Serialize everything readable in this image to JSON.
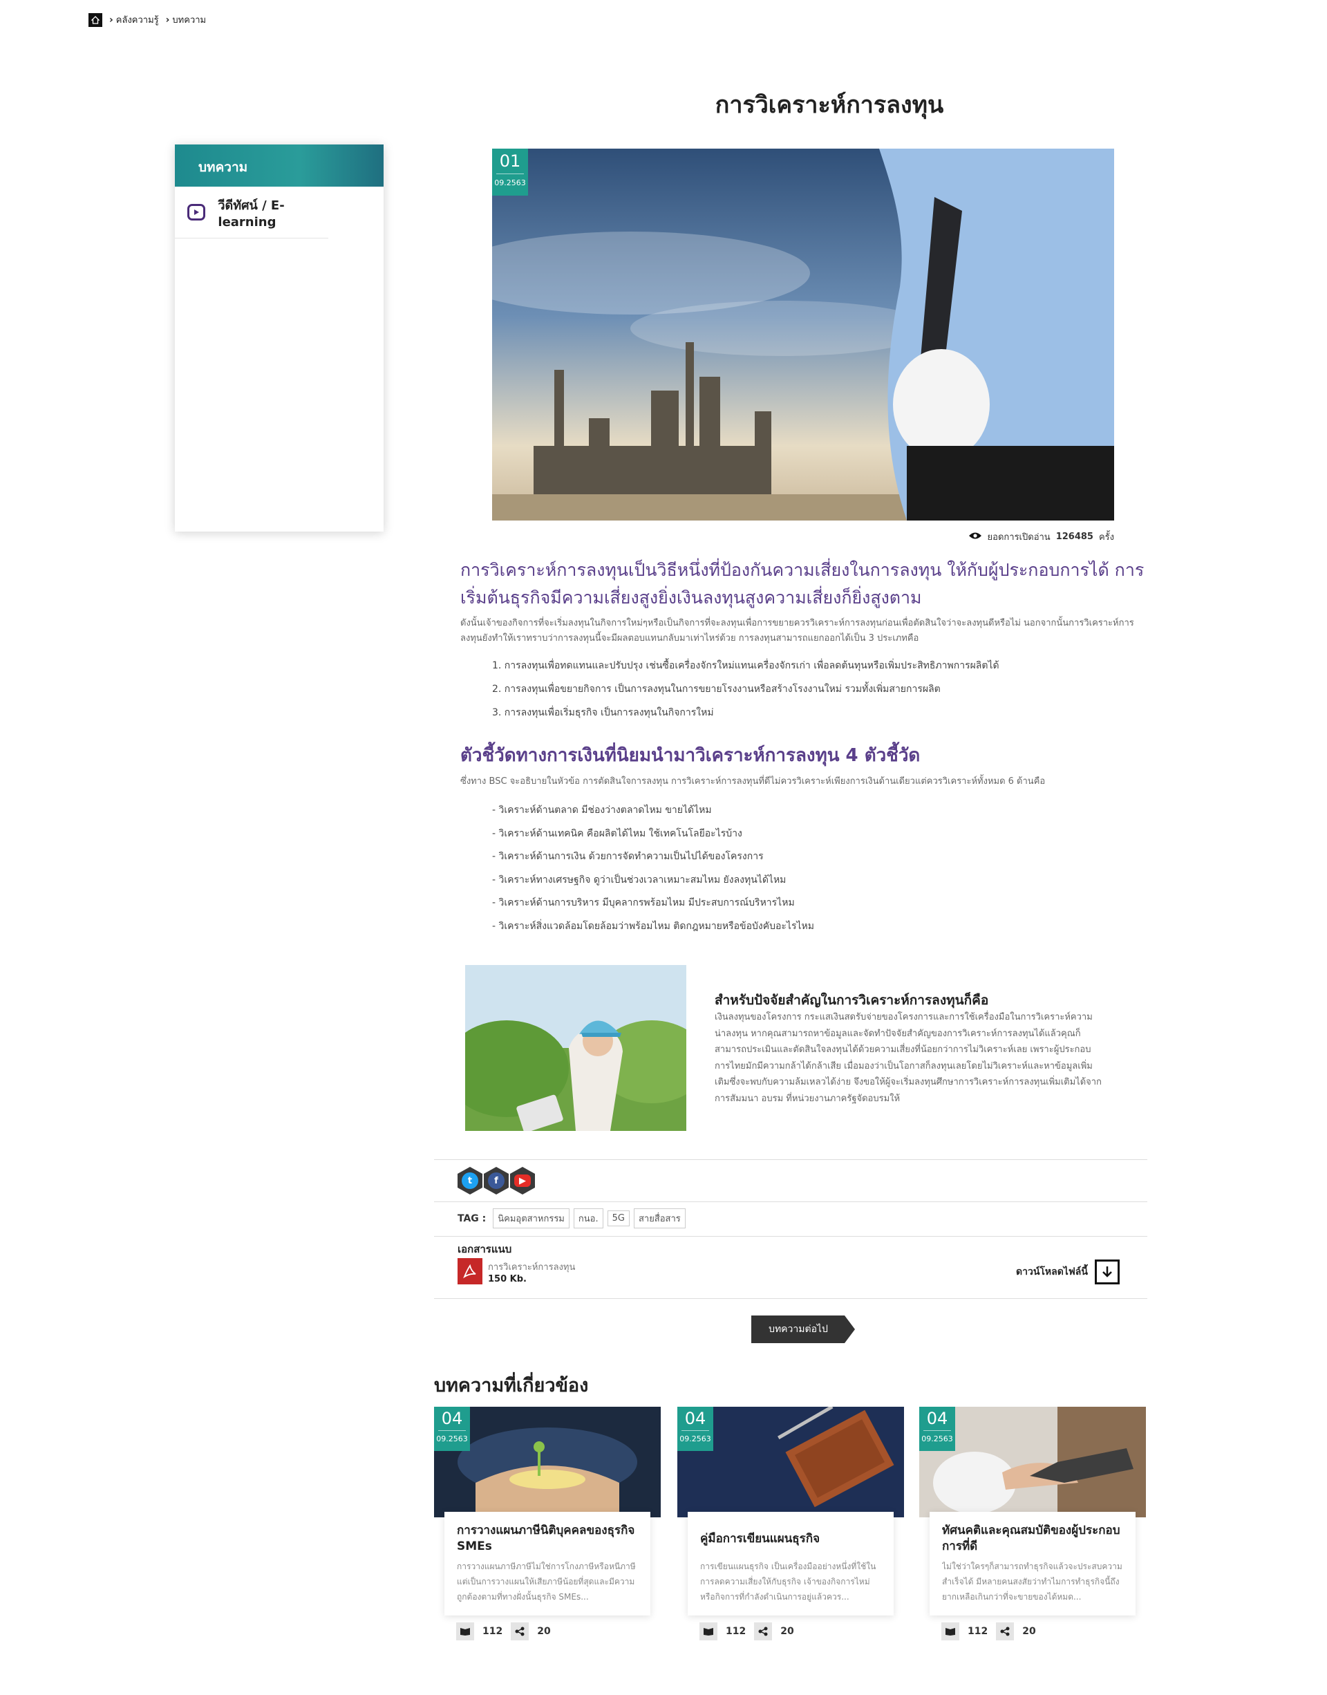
{
  "breadcrumb": {
    "items": [
      "คลังความรู้",
      "บทความ"
    ]
  },
  "page_title": "การวิเคราะห์การลงทุน",
  "sidebar": {
    "header": "บทความ",
    "items": [
      {
        "label": "วีดีทัศน์ / E-learning",
        "icon": "play-icon"
      }
    ]
  },
  "article": {
    "date_day": "01",
    "date_month": "09.2563",
    "views_text": "ยอดการเปิดอ่าน",
    "views_count": "126485",
    "views_unit": "ครั้ง",
    "lead": "การวิเคราะห์การลงทุนเป็นวิธีหนึ่งที่ป้องกันความเสี่ยงในการลงทุน ให้กับผู้ประกอบการได้ การเริ่มต้นธุรกิจมีความเสี่ยงสูงยิ่งเงินลงทุนสูงความเสี่ยงก็ยิ่งสูงตาม",
    "paragraph": "ดังนั้นเจ้าของกิจการที่จะเริ่มลงทุนในกิจการใหม่ๆหรือเป็นกิจการที่จะลงทุนเพื่อการขยายควรวิเคราะห์การลงทุนก่อนเพื่อตัดสินใจว่าจะลงทุนดีหรือไม่ นอกจากนั้นการวิเคราะห์การลงทุนยังทำให้เราทราบว่าการลงทุนนี้จะมีผลตอบแทนกลับมาเท่าไหร่ด้วย การลงทุนสามารถแยกออกได้เป็น 3 ประเภทคือ",
    "list1": [
      "1. การลงทุนเพื่อทดแทนและปรับปรุง เช่นซื้อเครื่องจักรใหม่แทนเครื่องจักรเก่า เพื่อลดต้นทุนหรือเพิ่มประสิทธิภาพการผลิตได้",
      "2. การลงทุนเพื่อขยายกิจการ เป็นการลงทุนในการขยายโรงงานหรือสร้างโรงงานใหม่ รวมทั้งเพิ่มสายการผลิต",
      "3. การลงทุนเพื่อเริ่มธุรกิจ เป็นการลงทุนในกิจการใหม่"
    ],
    "heading2": "ตัวชี้วัดทางการเงินที่นิยมนำมาวิเคราะห์การลงทุน 4 ตัวชี้วัด",
    "paragraph2": "ซึ่งทาง BSC จะอธิบายในหัวข้อ การตัดสินใจการลงทุน การวิเคราะห์การลงทุนที่ดีไม่ควรวิเคราะห์เพียงการเงินด้านเดียวแต่ควรวิเคราะห์ทั้งหมด 6 ด้านคือ",
    "list2": [
      "- วิเคราะห์ด้านตลาด มีช่องว่างตลาดไหม ขายได้ไหม",
      "- วิเคราะห์ด้านเทคนิค คือผลิตได้ไหม ใช้เทคโนโลยีอะไรบ้าง",
      "- วิเคราะห์ด้านการเงิน ด้วยการจัดทำความเป็นไปได้ของโครงการ",
      "- วิเคราะห์ทางเศรษฐกิจ ดูว่าเป็นช่วงเวลาเหมาะสมไหม ยังลงทุนได้ไหม",
      "- วิเคราะห์ด้านการบริหาร มีบุคลากรพร้อมไหม มีประสบการณ์บริหารไหม",
      "- วิเคราะห์สิ่งแวดล้อมโดยล้อมว่าพร้อมไหม ติดกฎหมายหรือข้อบังคับอะไรไหม"
    ],
    "feature_title": "สำหรับปัจจัยสำคัญในการวิเคราะห์การลงทุนก็คือ",
    "feature_text": "เงินลงทุนของโครงการ กระแสเงินสดรับจ่ายของโครงการและการใช้เครื่องมือในการวิเคราะห์ความน่าลงทุน หากคุณสามารถหาข้อมูลและจัดทำปัจจัยสำคัญของการวิเคราะห์การลงทุนได้แล้วคุณก็สามารถประเมินและตัดสินใจลงทุนได้ด้วยความเสี่ยงที่น้อยกว่าการไม่วิเคราะห์เลย เพราะผู้ประกอบการไทยมักมีความกล้าได้กล้าเสีย เมื่อมองว่าเป็นโอกาสก็ลงทุนเลยโดยไม่วิเคราะห์และหาข้อมูลเพิ่มเติมซึ่งจะพบกับความล้มเหลวได้ง่าย จึงขอให้ผู้จะเริ่มลงทุนศึกษาการวิเคราะห์การลงทุนเพิ่มเติมได้จากการสัมมนา อบรม ที่หน่วยงานภาครัฐจัดอบรมให้"
  },
  "social": [
    "twitter-icon",
    "facebook-icon",
    "youtube-icon"
  ],
  "tags": {
    "label": "TAG :",
    "items": [
      "นิคมอุตสาหกรรม",
      "กนอ.",
      "5G",
      "สายสื่อสาร"
    ]
  },
  "attachment": {
    "title": "เอกสารแนบ",
    "file_name": "การวิเคราะห์การลงทุน",
    "file_size": "150 Kb.",
    "download_label": "ดาวน์โหลดไฟล์นี้"
  },
  "next_button": "บทความต่อไป",
  "related": {
    "title": "บทความที่เกี่ยวข้อง",
    "cards": [
      {
        "day": "04",
        "month": "09.2563",
        "title": "การวางแผนภาษีนิติบุคคลของธุรกิจ SMEs",
        "text": "การวางแผนภาษีภาษีไม่ใช่การโกงภาษีหรือหนีภาษี แต่เป็นการวางแผนให้เสียภาษีน้อยที่สุดและมีความถูกต้องตามที่ทางฝั่งนั้นธุรกิจ SMEs...",
        "reads": "112",
        "shares": "20"
      },
      {
        "day": "04",
        "month": "09.2563",
        "title": "คู่มือการเขียนแผนธุรกิจ",
        "text": "การเขียนแผนธุรกิจ เป็นเครื่องมืออย่างหนึ่งที่ใช้ในการลดความเสี่ยงให้กับธุรกิจ เจ้าของกิจการไหม่หรือกิจการที่กำลังดำเนินการอยู่แล้วควร...",
        "reads": "112",
        "shares": "20"
      },
      {
        "day": "04",
        "month": "09.2563",
        "title": "ทัศนคติและคุณสมบัติของผู้ประกอบการที่ดี",
        "text": "ไม่ใช่ว่าใครๆก็สามารถทำธุรกิจแล้วจะประสบความสำเร็จได้ มีหลายคนสงสัยว่าทำไมการทำธุรกิจนี้ถึงยากเหลือเกินกว่าที่จะขายของได้หมด...",
        "reads": "112",
        "shares": "20"
      }
    ]
  },
  "colors": {
    "teal": "#1f9d8e",
    "purple": "#5a3f8a",
    "accent_cyan": "#4dd3e8"
  }
}
